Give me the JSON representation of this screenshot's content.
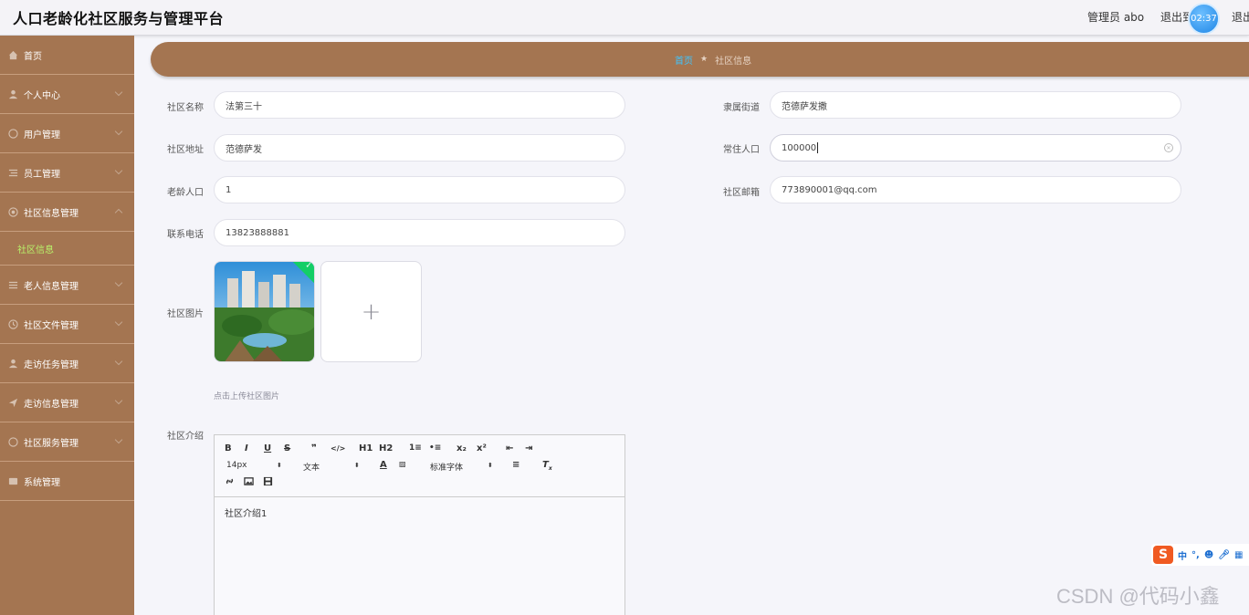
{
  "header": {
    "title": "人口老龄化社区服务与管理平台",
    "admin_label": "管理员 abo",
    "logout_1": "退出到前台",
    "logout_2": "退出登录",
    "timer": "02:37"
  },
  "sidebar": {
    "items": [
      {
        "label": "首页",
        "icon": "home-icon"
      },
      {
        "label": "个人中心",
        "icon": "user-icon"
      },
      {
        "label": "用户管理",
        "icon": "users-icon"
      },
      {
        "label": "员工管理",
        "icon": "list-icon"
      },
      {
        "label": "社区信息管理",
        "icon": "community-icon"
      },
      {
        "label": "社区信息",
        "icon": ""
      },
      {
        "label": "老人信息管理",
        "icon": "menu-icon"
      },
      {
        "label": "社区文件管理",
        "icon": "clock-icon"
      },
      {
        "label": "走访任务管理",
        "icon": "person-icon"
      },
      {
        "label": "走访信息管理",
        "icon": "send-icon"
      },
      {
        "label": "社区服务管理",
        "icon": "service-icon"
      },
      {
        "label": "系统管理",
        "icon": "system-icon"
      }
    ]
  },
  "breadcrumb": {
    "home": "首页",
    "separator": "★",
    "current": "社区信息"
  },
  "form": {
    "name": {
      "label": "社区名称",
      "value": "法第三十"
    },
    "street": {
      "label": "隶属街道",
      "value": "范德萨发撒"
    },
    "address": {
      "label": "社区地址",
      "value": "范德萨发"
    },
    "population": {
      "label": "常住人口",
      "value": "100000"
    },
    "elderly": {
      "label": "老龄人口",
      "value": "1"
    },
    "email": {
      "label": "社区邮箱",
      "value": "773890001@qq.com"
    },
    "phone": {
      "label": "联系电话",
      "value": "13823888881"
    },
    "image": {
      "label": "社区图片",
      "tip": "点击上传社区图片",
      "plus": "+"
    },
    "intro": {
      "label": "社区介绍",
      "content": "社区介绍1"
    }
  },
  "editor": {
    "font_size": "14px",
    "text_type": "文本",
    "font_family": "标准字体",
    "buttons_row1": [
      "B",
      "I",
      "U",
      "S",
      "❞",
      "</>",
      "H1",
      "H2",
      "1≡",
      "•≡",
      "x₂",
      "x²",
      "⇤",
      "⇥"
    ]
  },
  "ime": {
    "logo": "S",
    "label": "中"
  },
  "watermark": "CSDN @代码小鑫"
}
